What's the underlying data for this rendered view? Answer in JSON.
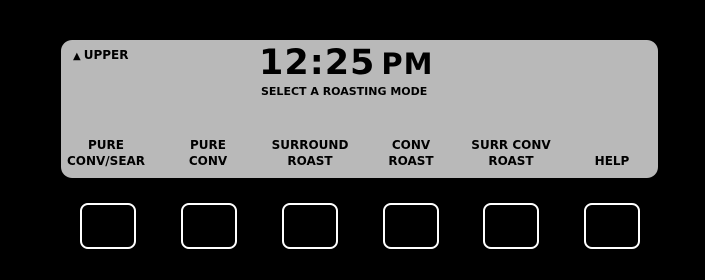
{
  "display": {
    "oven": {
      "icon": "triangle-up-icon",
      "label": "UPPER"
    },
    "time": "12:25",
    "ampm": "PM",
    "prompt": "SELECT A ROASTING MODE"
  },
  "softkeys": [
    {
      "line1": "PURE",
      "line2": "CONV/SEAR"
    },
    {
      "line1": "PURE",
      "line2": "CONV"
    },
    {
      "line1": "SURROUND",
      "line2": "ROAST"
    },
    {
      "line1": "CONV",
      "line2": "ROAST"
    },
    {
      "line1": "SURR CONV",
      "line2": "ROAST"
    },
    {
      "line1": "",
      "line2": "HELP"
    }
  ],
  "colors": {
    "panel": "#000000",
    "lcd": "#b9b9b9",
    "button_border": "#ffffff"
  }
}
